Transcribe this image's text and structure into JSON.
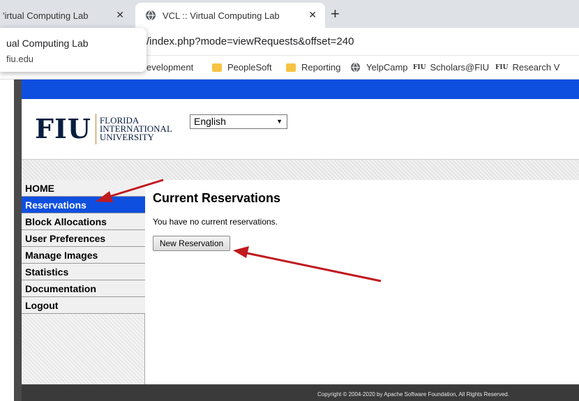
{
  "browser": {
    "tabs": [
      {
        "label": "'irtual Computing Lab"
      },
      {
        "label": "VCL :: Virtual Computing Lab"
      }
    ],
    "address": "/index.php?mode=viewRequests&offset=240",
    "popup": {
      "title": "ual Computing Lab",
      "domain": "fiu.edu"
    },
    "bookmarks": [
      "evelopment",
      "PeopleSoft",
      "Reporting",
      "YelpCamp",
      "Scholars@FIU",
      "Research V"
    ],
    "bookmark_fiu_mark": "FIU"
  },
  "header": {
    "logo_mark": "FIU",
    "logo_lines": [
      "FLORIDA",
      "INTERNATIONAL",
      "UNIVERSITY"
    ],
    "language": "English"
  },
  "nav": {
    "items": [
      {
        "label": "HOME",
        "active": false
      },
      {
        "label": "Reservations",
        "active": true
      },
      {
        "label": "Block Allocations",
        "active": false
      },
      {
        "label": "User Preferences",
        "active": false
      },
      {
        "label": "Manage Images",
        "active": false
      },
      {
        "label": "Statistics",
        "active": false
      },
      {
        "label": "Documentation",
        "active": false
      },
      {
        "label": "Logout",
        "active": false
      }
    ]
  },
  "main": {
    "title": "Current Reservations",
    "message": "You have no current reservations.",
    "new_button": "New Reservation"
  },
  "footer": {
    "copyright": "Copyright © 2004-2020 by Apache Software Foundation, All Rights Reserved."
  },
  "colors": {
    "accent_blue": "#0f4fe0",
    "fiu_navy": "#081e3f",
    "annotation_red": "#c0191f"
  }
}
